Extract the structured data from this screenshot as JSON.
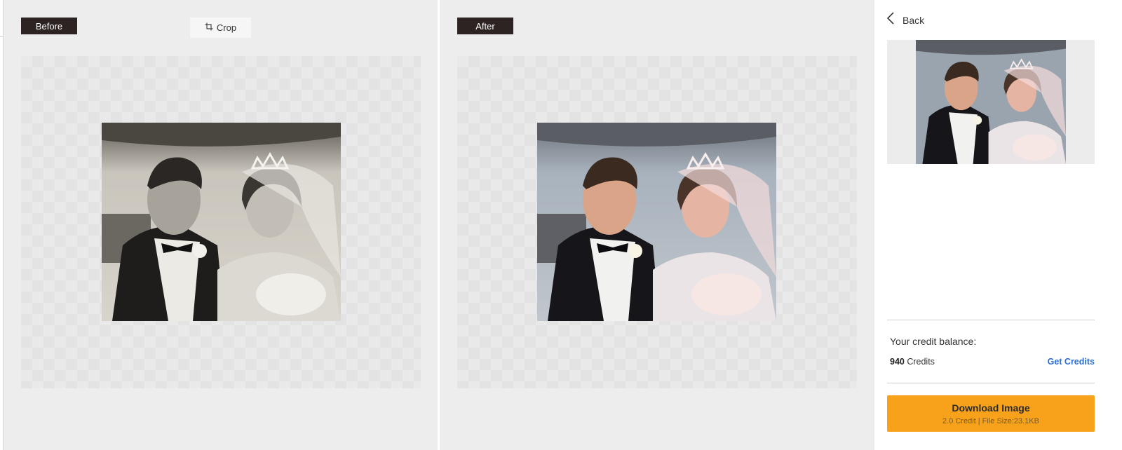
{
  "before_pane": {
    "label": "Before",
    "crop_label": "Crop"
  },
  "after_pane": {
    "label": "After"
  },
  "sidebar": {
    "back_label": "Back",
    "credit_balance_title": "Your credit balance:",
    "credits_count": "940",
    "credits_unit": "Credits",
    "get_credits_label": "Get Credits",
    "download": {
      "label": "Download Image",
      "subtext": "2.0 Credit | File Size:23.1KB"
    }
  },
  "colors": {
    "accent_orange": "#f8a21c",
    "link_blue": "#2a6fd6",
    "label_chip": "#2e2323"
  }
}
